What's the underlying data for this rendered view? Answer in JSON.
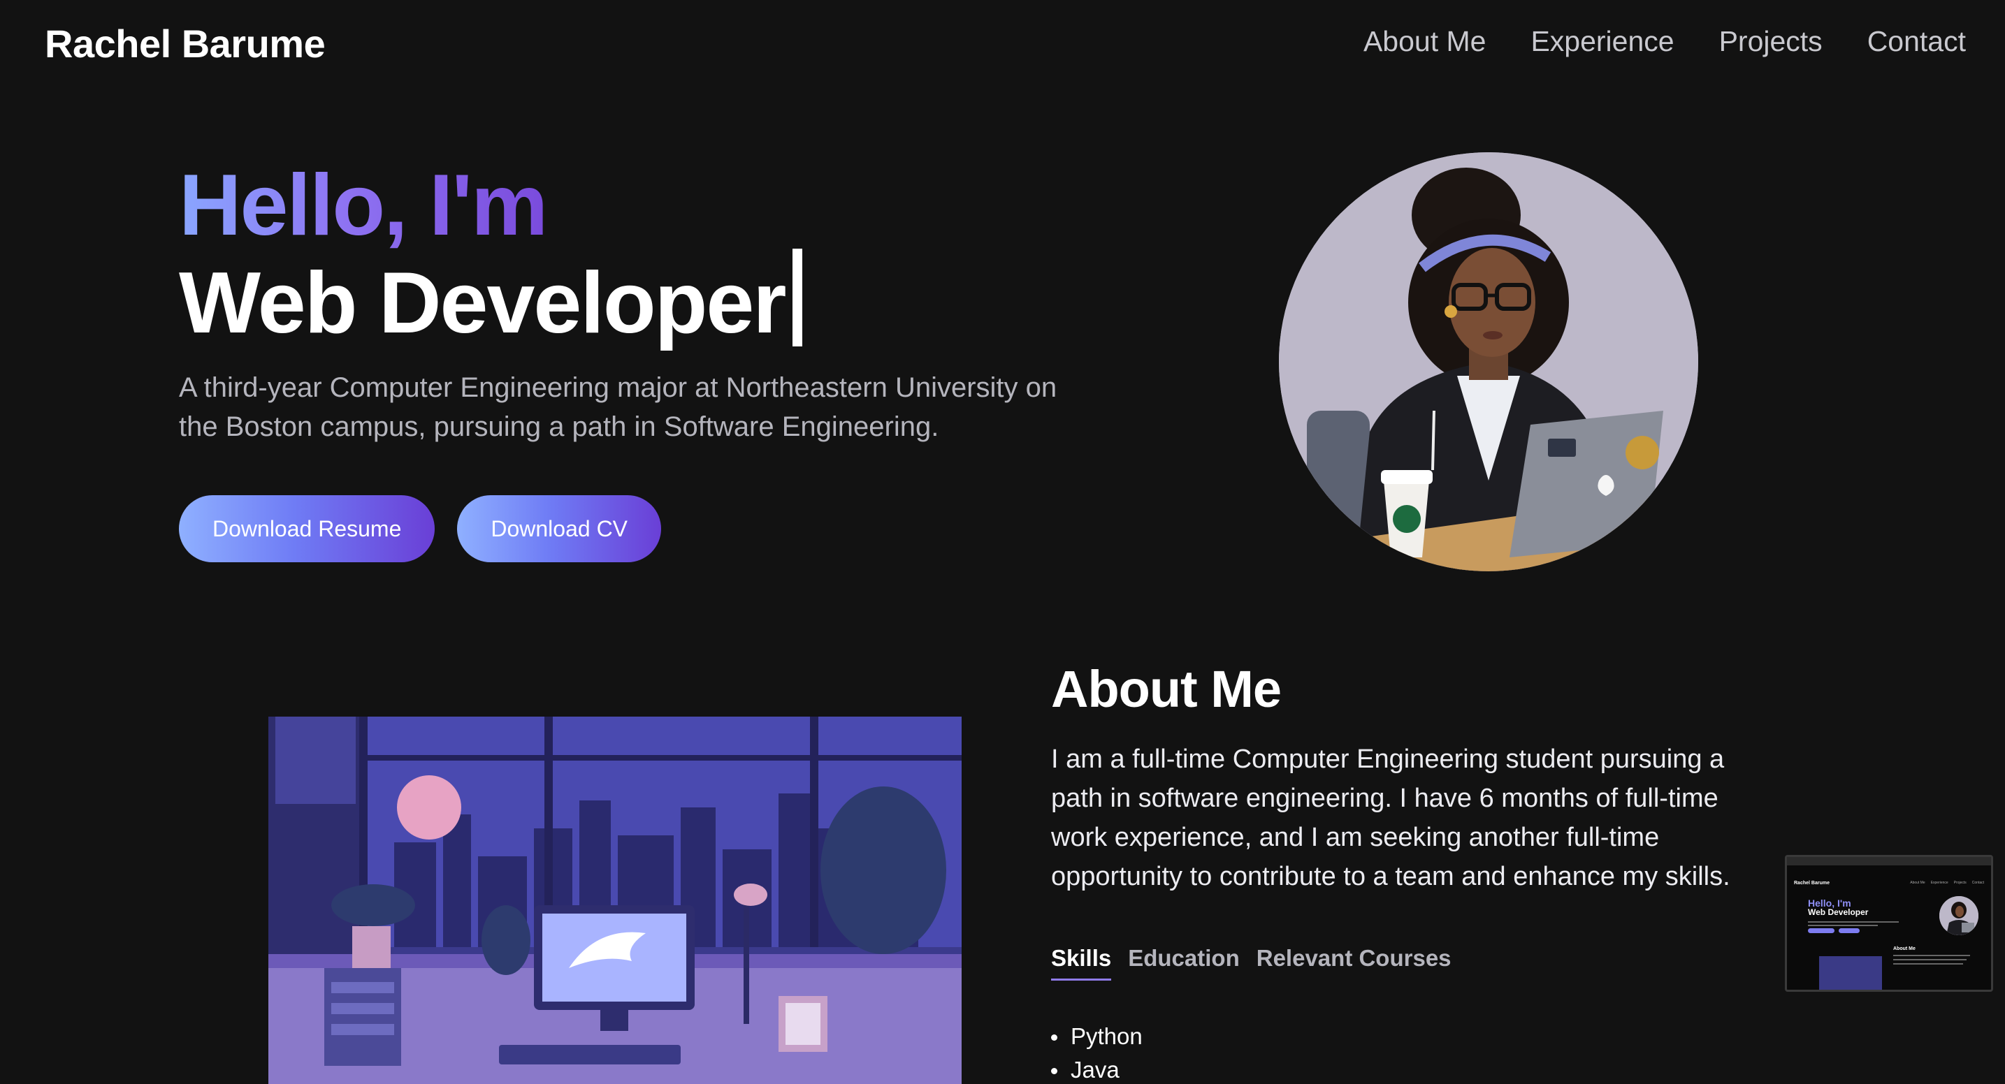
{
  "header": {
    "brand": "Rachel Barume",
    "nav": [
      "About Me",
      "Experience",
      "Projects",
      "Contact"
    ]
  },
  "hero": {
    "greeting": "Hello, I'm",
    "role": "Web Developer",
    "intro_line1": "A third-year Computer Engineering major at Northeastern University on",
    "intro_line2": "the Boston campus, pursuing a path in Software Engineering.",
    "buttons": [
      "Download Resume",
      "Download CV"
    ]
  },
  "about": {
    "title": "About Me",
    "text": "I am a full-time Computer Engineering student pursuing a path in software engineering. I have 6 months of full-time work experience, and I am seeking another full-time opportunity to contribute to a team and enhance my skills.",
    "tabs": [
      "Skills",
      "Education",
      "Relevant Courses"
    ],
    "active_tab": "Skills",
    "skills": [
      "Python",
      "Java"
    ]
  },
  "thumbnail": {
    "brand": "Rachel Barume",
    "nav": [
      "About Me",
      "Experience",
      "Projects",
      "Contact"
    ],
    "greeting": "Hello, I'm",
    "role": "Web Developer",
    "about_title": "About Me"
  },
  "colors": {
    "background": "#121212",
    "accent_start": "#8fb0ff",
    "accent_end": "#6a3fd6",
    "tab_underline": "#8f7be8"
  }
}
